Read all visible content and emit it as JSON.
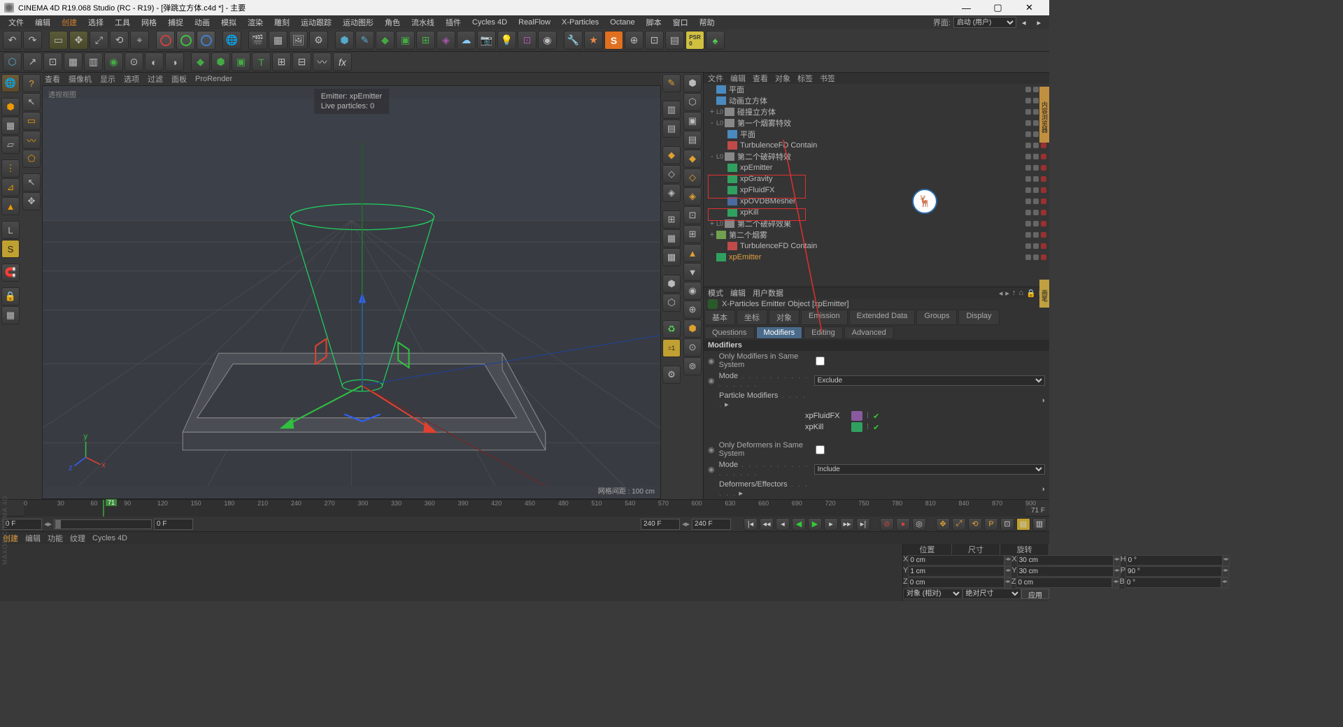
{
  "app": {
    "title": "CINEMA 4D R19.068 Studio (RC - R19) - [弹跳立方体.c4d *] - 主要",
    "layout_label": "界面:",
    "layout_value": "启动 (用户)"
  },
  "menu": [
    "文件",
    "编辑",
    "创建",
    "选择",
    "工具",
    "网格",
    "捕捉",
    "动画",
    "模拟",
    "渲染",
    "雕刻",
    "运动跟踪",
    "运动图形",
    "角色",
    "流水线",
    "插件",
    "Cycles 4D",
    "RealFlow",
    "X-Particles",
    "Octane",
    "脚本",
    "窗口",
    "帮助"
  ],
  "menu_orange_idx": 2,
  "viewmenu": [
    "查看",
    "摄像机",
    "显示",
    "选项",
    "过滤",
    "面板",
    "ProRender"
  ],
  "view": {
    "label": "透视视图",
    "emitter": "Emitter: xpEmitter",
    "particles": "Live particles: 0",
    "gridinfo": "网格间距 : 100 cm"
  },
  "om_tabs": [
    "文件",
    "编辑",
    "查看",
    "对象",
    "标签",
    "书签"
  ],
  "tree": [
    {
      "d": 0,
      "e": "",
      "i": "#4a8ac0",
      "n": "平面"
    },
    {
      "d": 0,
      "e": "",
      "i": "#4a8ac0",
      "n": "动画立方体"
    },
    {
      "d": 0,
      "e": "+",
      "i": "#888",
      "n": "碰撞立方体",
      "pre": "L0"
    },
    {
      "d": 0,
      "e": "-",
      "i": "#888",
      "n": "第一个烟雾特效",
      "pre": "L0"
    },
    {
      "d": 1,
      "e": "",
      "i": "#4a8ac0",
      "n": "平面"
    },
    {
      "d": 1,
      "e": "",
      "i": "#c04a4a",
      "n": "TurbulenceFD Contain"
    },
    {
      "d": 0,
      "e": "-",
      "i": "#888",
      "n": "第二个破碎特效",
      "pre": "L0"
    },
    {
      "d": 1,
      "e": "",
      "i": "#30a060",
      "n": "xpEmitter"
    },
    {
      "d": 1,
      "e": "",
      "i": "#30a060",
      "n": "xpGravity"
    },
    {
      "d": 1,
      "e": "",
      "i": "#30a060",
      "n": "xpFluidFX"
    },
    {
      "d": 1,
      "e": "",
      "i": "#4a6aa0",
      "n": "xpOVDBMesher"
    },
    {
      "d": 1,
      "e": "",
      "i": "#30a060",
      "n": "xpKill"
    },
    {
      "d": 0,
      "e": "+",
      "i": "#888",
      "n": "第二个破碎效果",
      "pre": "L0"
    },
    {
      "d": 0,
      "e": "+",
      "i": "#70a050",
      "n": "第二个烟雾"
    },
    {
      "d": 1,
      "e": "",
      "i": "#c04a4a",
      "n": "TurbulenceFD Contain"
    },
    {
      "d": 0,
      "e": "",
      "i": "#30a060",
      "n": "xpEmitter",
      "sel": true
    }
  ],
  "attr_mode_tabs": [
    "模式",
    "编辑",
    "用户数据"
  ],
  "attr_title": "X-Particles Emitter Object [xpEmitter]",
  "attr_tabs_row1": [
    "基本",
    "坐标",
    "对象",
    "Emission",
    "Extended Data",
    "Groups",
    "Display"
  ],
  "attr_tabs_row2": [
    "Questions",
    "Modifiers",
    "Editing",
    "Advanced"
  ],
  "attr_active_tab": "Modifiers",
  "attrs": {
    "section": "Modifiers",
    "only_mod": "Only Modifiers in Same System",
    "mode": "Mode",
    "mode_val": "Exclude",
    "pmod": "Particle Modifiers",
    "mods": [
      {
        "name": "xpFluidFX",
        "color": "#8a5aa0"
      },
      {
        "name": "xpKill",
        "color": "#30a060"
      }
    ],
    "only_def": "Only Deformers in Same System",
    "mode2_val": "Include",
    "def": "Deformers/Effectors"
  },
  "timeline": {
    "start": 0,
    "end": 900,
    "cur": 71,
    "curlbl": "71",
    "rightlbl": "71 F",
    "ticks": [
      0,
      30,
      60,
      90,
      120,
      150,
      180,
      210,
      240,
      270,
      300,
      330,
      360,
      390,
      420,
      450,
      480,
      510,
      540,
      570,
      600,
      630,
      660,
      690,
      720,
      750,
      780,
      810,
      840,
      870,
      900
    ]
  },
  "play": {
    "f1": "0 F",
    "f2": "0 F",
    "f3": "240 F",
    "f4": "240 F"
  },
  "mat_tabs": [
    "创建",
    "编辑",
    "功能",
    "纹理",
    "Cycles 4D"
  ],
  "coords": {
    "hdr": [
      "位置",
      "尺寸",
      "旋转"
    ],
    "rows": [
      {
        "l": "X",
        "p": "0 cm",
        "s": "30 cm",
        "r": "0 °",
        "rl": "H"
      },
      {
        "l": "Y",
        "p": "1 cm",
        "s": "30 cm",
        "r": "90 °",
        "rl": "P"
      },
      {
        "l": "Z",
        "p": "0 cm",
        "s": "0 cm",
        "r": "0 °",
        "rl": "B"
      }
    ],
    "objmode": "对象 (相对)",
    "sizemode": "绝对尺寸",
    "apply": "应用"
  },
  "brand": "MAXON CINEMA 4D"
}
